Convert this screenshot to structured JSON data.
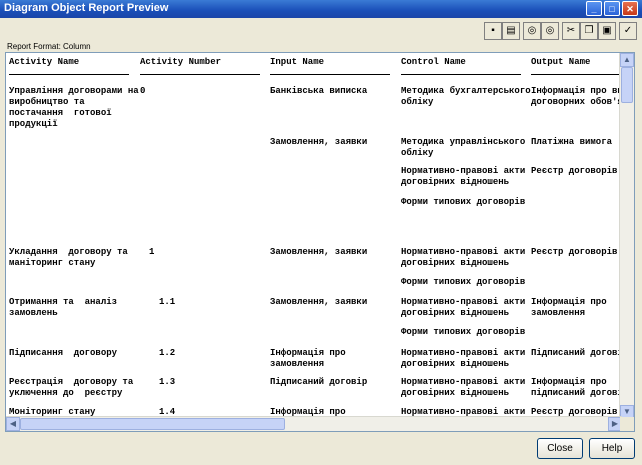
{
  "window": {
    "title": "Diagram Object Report Preview"
  },
  "toolbar": {
    "icons": [
      "save-icon",
      "print-icon",
      "find-icon",
      "find-next-icon",
      "cut-icon",
      "copy-icon",
      "paste-icon",
      "check-icon"
    ]
  },
  "report_format": "Report Format: Column",
  "columns": [
    "Activity Name",
    "Activity Number",
    "Input Name",
    "Control Name",
    "Output Name"
  ],
  "rows": [
    {
      "activity": "Управління договорами на\nвиробництво та\nпостачання  готової\nпродукції",
      "number": "0",
      "input": "Банківська виписка",
      "control": "Методика бухгалтерського\nобліку",
      "output": "Інформація про вико\nдоговорних обов'язк"
    },
    {
      "activity": "",
      "number": "",
      "input": "Замовлення, заявки",
      "control": "Методика управлінського\nобліку",
      "output": "Платіжна вимога"
    },
    {
      "activity": "",
      "number": "",
      "input": "",
      "control": "Нормативно-правові акти\nдоговірних відношень",
      "output": "Реєстр договорів"
    },
    {
      "activity": "",
      "number": "",
      "input": "",
      "control": "Форми типових договорів",
      "output": ""
    },
    {
      "activity": "Укладання  договору та\nманіторинг стану",
      "number": "1",
      "input": "Замовлення, заявки",
      "control": "Нормативно-правові акти\nдоговірних відношень",
      "output": "Реєстр договорів"
    },
    {
      "activity": "",
      "number": "",
      "input": "",
      "control": "Форми типових договорів",
      "output": ""
    },
    {
      "activity": "Отримання та  аналіз\nзамовлень",
      "number": "1.1",
      "input": "Замовлення, заявки",
      "control": "Нормативно-правові акти\nдоговірних відношень",
      "output": "Інформація про\nзамовлення"
    },
    {
      "activity": "",
      "number": "",
      "input": "",
      "control": "Форми типових договорів",
      "output": ""
    },
    {
      "activity": "Підписання  договору",
      "number": "1.2",
      "input": "Інформація про\nзамовлення",
      "control": "Нормативно-правові акти\nдоговірних відношень",
      "output": "Підписаний договір"
    },
    {
      "activity": "Реєстрація  договору та\nуключення до  реєстру",
      "number": "1.3",
      "input": "Підписаний договір",
      "control": "Нормативно-правові акти\nдоговірних відношень",
      "output": "Інформація про\nпідписаний договір"
    },
    {
      "activity": "Моніторинг стану",
      "number": "1.4",
      "input": "Інформація про",
      "control": "Нормативно-правові акти",
      "output": "Реєстр договорів"
    }
  ],
  "buttons": {
    "close": "Close",
    "help": "Help"
  }
}
